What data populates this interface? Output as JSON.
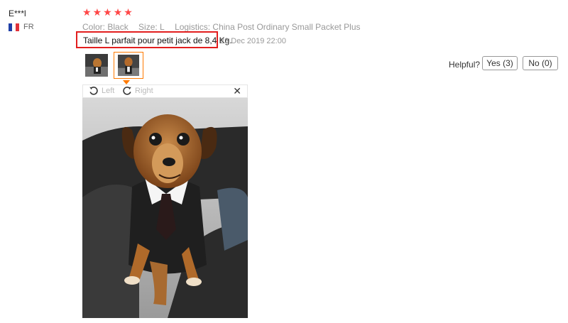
{
  "reviewer": {
    "name": "E***l",
    "country": "FR"
  },
  "rating": {
    "stars": 5,
    "star_symbol": "★"
  },
  "meta": {
    "color": "Color: Black",
    "size": "Size: L",
    "logistics": "Logistics: China Post Ordinary Small Packet Plus"
  },
  "review": {
    "text": "Taille L parfait pour petit jack de 8,4 Kg.",
    "date": "23 Dec 2019 22:00"
  },
  "helpful": {
    "label": "Helpful?",
    "yes": "Yes (3)",
    "no": "No (0)"
  },
  "viewer": {
    "left_label": "Left",
    "right_label": "Right",
    "close_symbol": "✕"
  },
  "colors": {
    "star": "#ff4747",
    "highlight_border": "#e21e1e",
    "thumb_border": "#ff7a00"
  },
  "icons": [
    "france-flag-icon",
    "star-icon",
    "rotate-left-icon",
    "rotate-right-icon",
    "close-icon"
  ]
}
